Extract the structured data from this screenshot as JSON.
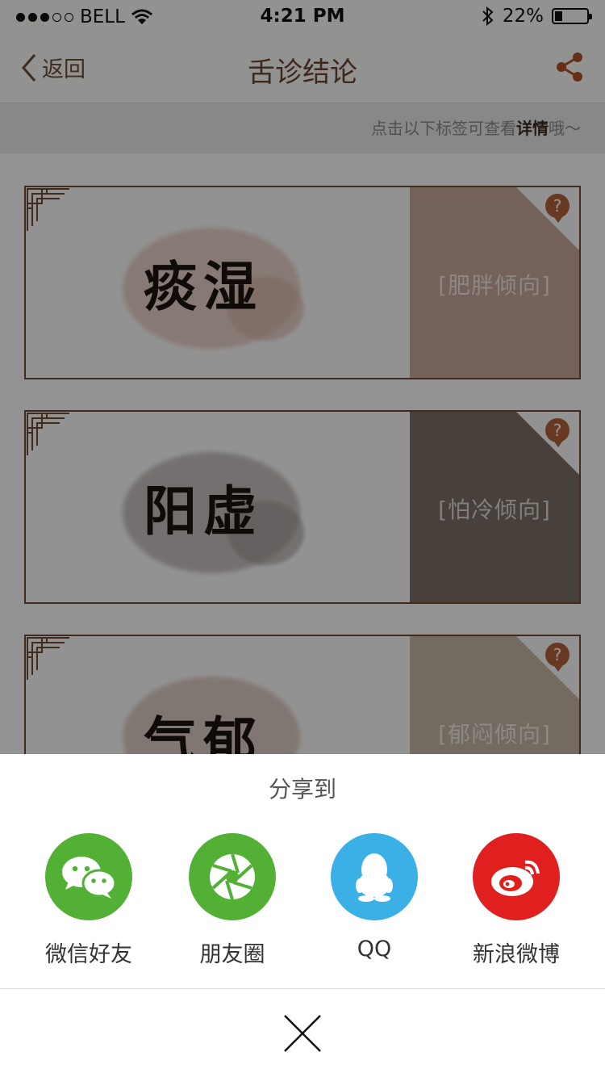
{
  "status_bar": {
    "carrier": "BELL",
    "time": "4:21 PM",
    "battery": "22%",
    "battery_level": 0.22
  },
  "nav": {
    "back_label": "返回",
    "title": "舌诊结论"
  },
  "hint": {
    "prefix": "点击以下标签可查看",
    "highlight": "详情",
    "suffix": "哦～"
  },
  "cards": [
    {
      "name": "痰湿",
      "tag": "[肥胖倾向]",
      "help": "?",
      "panel_color": "#c8a89a",
      "ink_color": "#d9b0a0"
    },
    {
      "name": "阳虚",
      "tag": "[怕冷倾向]",
      "help": "?",
      "panel_color": "#7c6f66",
      "ink_color": "#9e9490"
    },
    {
      "name": "气郁",
      "tag": "[郁闷倾向]",
      "help": "?",
      "panel_color": "#c8b8a6",
      "ink_color": "#c8a898"
    }
  ],
  "share_sheet": {
    "title": "分享到",
    "targets": [
      {
        "label": "微信好友",
        "icon": "wechat-icon",
        "color": "#52b035"
      },
      {
        "label": "朋友圈",
        "icon": "moments-icon",
        "color": "#52b035"
      },
      {
        "label": "QQ",
        "icon": "qq-icon",
        "color": "#3ab0e6"
      },
      {
        "label": "新浪微博",
        "icon": "weibo-icon",
        "color": "#e0201f"
      }
    ],
    "close_icon": "close-icon"
  }
}
